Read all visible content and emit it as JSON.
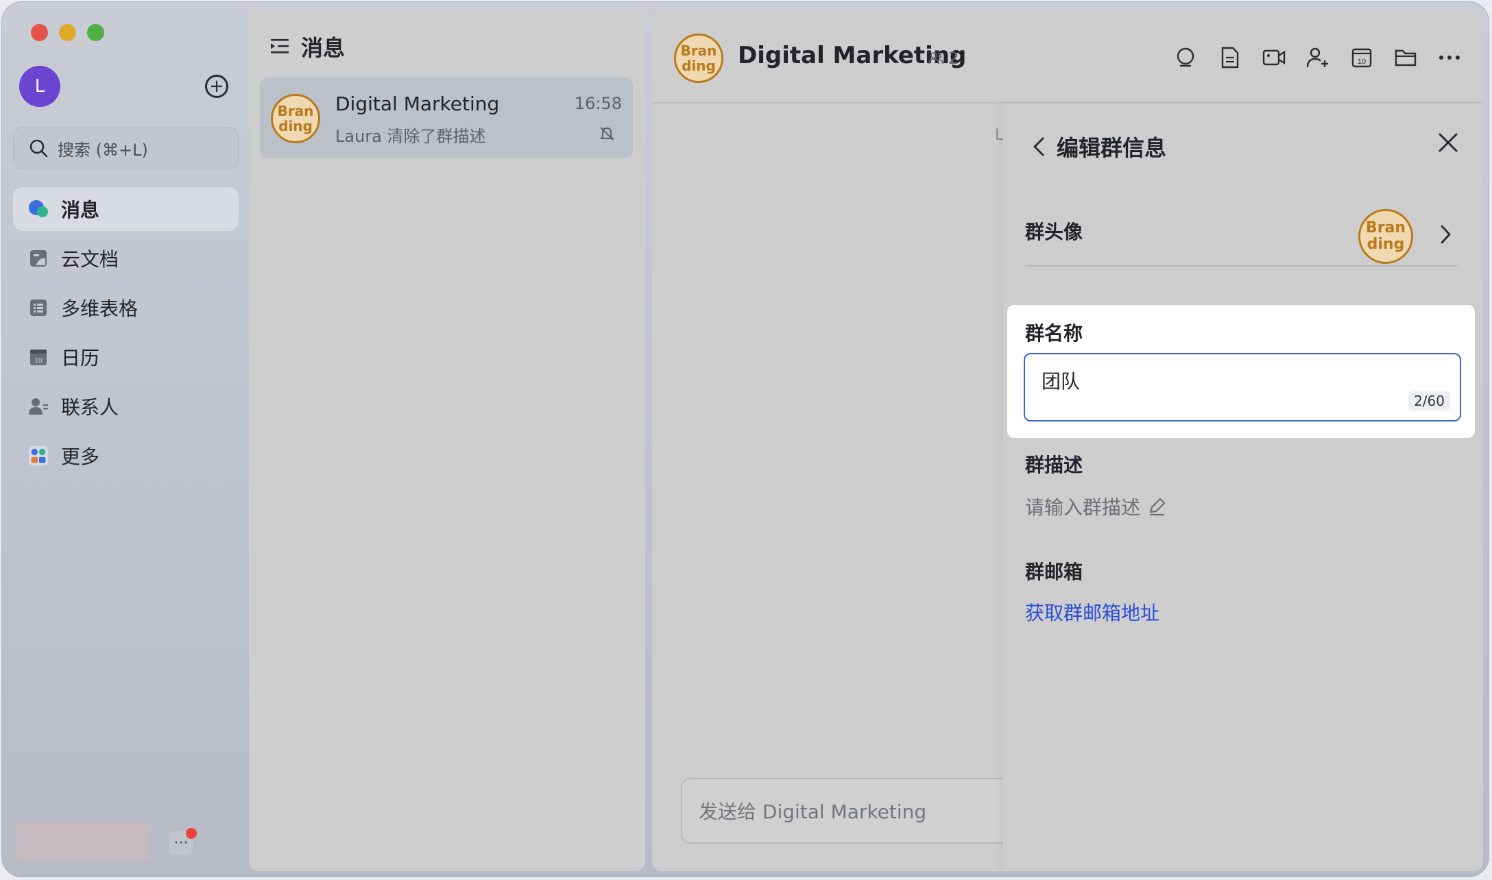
{
  "sidebar": {
    "avatar_letter": "L",
    "search_placeholder": "搜索 (⌘+L)",
    "items": [
      {
        "label": "消息"
      },
      {
        "label": "云文档"
      },
      {
        "label": "多维表格"
      },
      {
        "label": "日历"
      },
      {
        "label": "联系人"
      },
      {
        "label": "更多"
      }
    ],
    "more_dots": "···"
  },
  "message_list": {
    "title": "消息",
    "chats": [
      {
        "avatar_text": "Bran ding",
        "name": "Digital Marketing",
        "time": "16:58",
        "preview": "Laura 清除了群描述"
      }
    ]
  },
  "chat": {
    "avatar_text": "Bran ding",
    "title": "Digital Marketing",
    "member_count": "2",
    "stray_char": "L",
    "compose_placeholder": "发送给 Digital Marketing"
  },
  "edit_panel": {
    "title": "编辑群信息",
    "avatar_label": "群头像",
    "avatar_text": "Bran ding",
    "name_label": "群名称",
    "name_value": "团队",
    "name_counter": "2/60",
    "desc_label": "群描述",
    "desc_placeholder": "请输入群描述",
    "mail_label": "群邮箱",
    "mail_link": "获取群邮箱地址"
  },
  "colors": {
    "accent": "#3a63d8",
    "link": "#2a4fd6",
    "brand_avatar": "#b87a1c",
    "user_avatar": "#6b45d0",
    "notification": "#e8443a"
  }
}
